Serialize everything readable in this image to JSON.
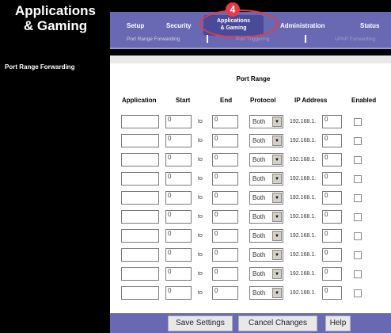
{
  "section_title": [
    "Applications",
    "& Gaming"
  ],
  "top_nav": {
    "setup": "Setup",
    "security": "Security",
    "applications_gaming": [
      "Applications",
      "& Gaming"
    ],
    "administration": "Administration",
    "status": "Status"
  },
  "step_badge": "4",
  "sub_nav": {
    "port_range_forwarding": "Port Range Forwarding",
    "port_triggering": "Port Triggering",
    "upnp_forwarding": "UPnP Forwarding"
  },
  "left_heading": "Port Range Forwarding",
  "table": {
    "group_header": "Port Range",
    "columns": [
      "Application",
      "Start",
      "End",
      "Protocol",
      "IP Address",
      "Enabled"
    ],
    "to_label": "to",
    "ip_prefix": "192.168.1.",
    "rows": [
      {
        "application": "",
        "start": "0",
        "end": "0",
        "protocol": "Both",
        "ip_last": "0",
        "enabled": false
      },
      {
        "application": "",
        "start": "0",
        "end": "0",
        "protocol": "Both",
        "ip_last": "0",
        "enabled": false
      },
      {
        "application": "",
        "start": "0",
        "end": "0",
        "protocol": "Both",
        "ip_last": "0",
        "enabled": false
      },
      {
        "application": "",
        "start": "0",
        "end": "0",
        "protocol": "Both",
        "ip_last": "0",
        "enabled": false
      },
      {
        "application": "",
        "start": "0",
        "end": "0",
        "protocol": "Both",
        "ip_last": "0",
        "enabled": false
      },
      {
        "application": "",
        "start": "0",
        "end": "0",
        "protocol": "Both",
        "ip_last": "0",
        "enabled": false
      },
      {
        "application": "",
        "start": "0",
        "end": "0",
        "protocol": "Both",
        "ip_last": "0",
        "enabled": false
      },
      {
        "application": "",
        "start": "0",
        "end": "0",
        "protocol": "Both",
        "ip_last": "0",
        "enabled": false
      },
      {
        "application": "",
        "start": "0",
        "end": "0",
        "protocol": "Both",
        "ip_last": "0",
        "enabled": false
      },
      {
        "application": "",
        "start": "0",
        "end": "0",
        "protocol": "Both",
        "ip_last": "0",
        "enabled": false
      }
    ]
  },
  "footer": {
    "save": "Save Settings",
    "cancel": "Cancel Changes",
    "help": "Help"
  },
  "colors": {
    "nav_bar": "#6969b3",
    "active_tab": "#4a4a9a",
    "highlight": "#e23a4a",
    "background": "#000000"
  }
}
